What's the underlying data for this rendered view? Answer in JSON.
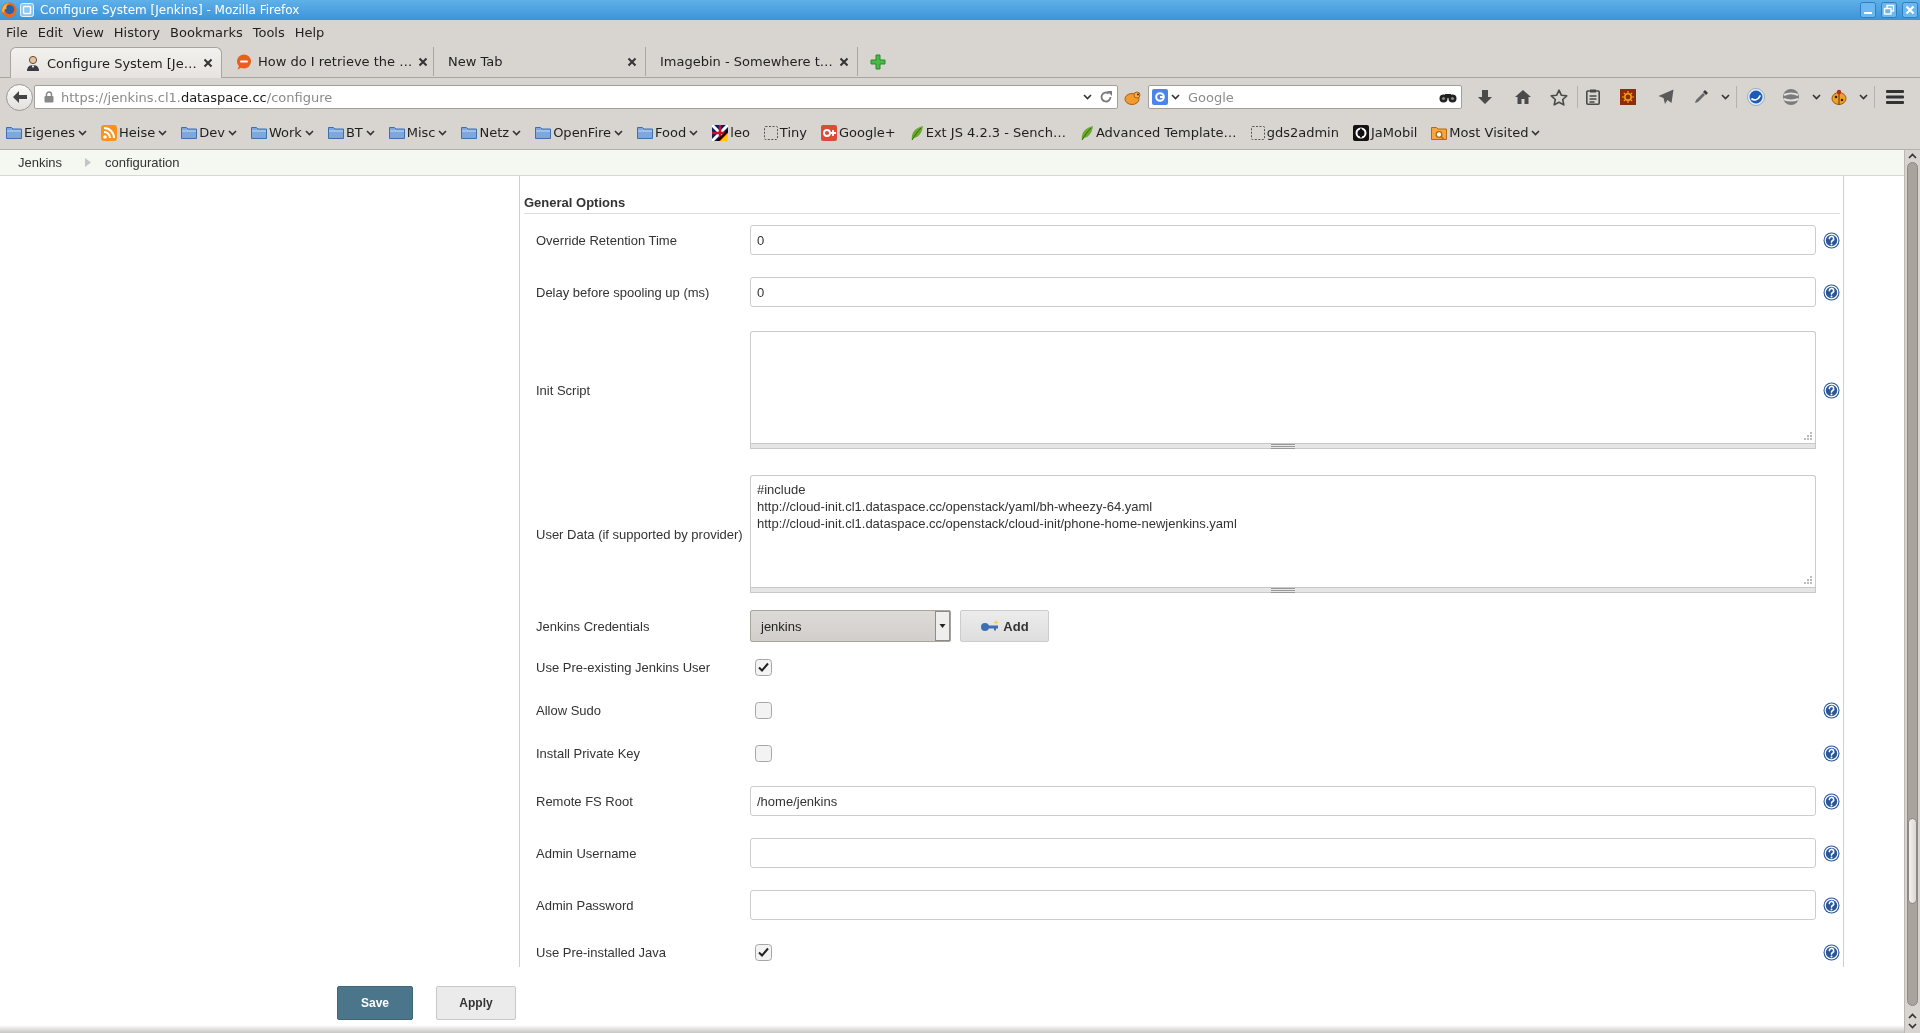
{
  "window": {
    "title": "Configure System [Jenkins] - Mozilla Firefox"
  },
  "menu": [
    "File",
    "Edit",
    "View",
    "History",
    "Bookmarks",
    "Tools",
    "Help"
  ],
  "tabs": [
    {
      "label": "Configure System [Je…",
      "selected": true,
      "kind": "person"
    },
    {
      "label": "How do I retrieve the …",
      "selected": false,
      "kind": "bubble"
    },
    {
      "label": "New Tab",
      "selected": false,
      "kind": "blank"
    },
    {
      "label": "Imagebin - Somewhere t…",
      "selected": false,
      "kind": "blank"
    }
  ],
  "address": {
    "parts": [
      {
        "text": "https://jenkins.cl1.",
        "strong": false
      },
      {
        "text": "dataspace.cc",
        "strong": true
      },
      {
        "text": "/configure",
        "strong": false
      }
    ]
  },
  "search": {
    "placeholder": "Google"
  },
  "bookmarks": [
    {
      "label": "Eigenes",
      "kind": "folder",
      "menu": true
    },
    {
      "label": "Heise",
      "kind": "feed",
      "menu": true
    },
    {
      "label": "Dev",
      "kind": "folder",
      "menu": true
    },
    {
      "label": "Work",
      "kind": "folder",
      "menu": true
    },
    {
      "label": "BT",
      "kind": "folder",
      "menu": true
    },
    {
      "label": "Misc",
      "kind": "folder",
      "menu": true
    },
    {
      "label": "Netz",
      "kind": "folder",
      "menu": true
    },
    {
      "label": "OpenFire",
      "kind": "folder",
      "menu": true
    },
    {
      "label": "Food",
      "kind": "folder",
      "menu": true
    },
    {
      "label": "leo",
      "kind": "flag",
      "menu": false
    },
    {
      "label": "Tiny",
      "kind": "blank",
      "menu": false
    },
    {
      "label": "Google+",
      "kind": "plus",
      "menu": false
    },
    {
      "label": "Ext JS 4.2.3 - Sench…",
      "kind": "leaf",
      "menu": false
    },
    {
      "label": "Advanced Template…",
      "kind": "leaf",
      "menu": false
    },
    {
      "label": "gds2admin",
      "kind": "blank",
      "menu": false
    },
    {
      "label": "JaMobil",
      "kind": "app",
      "menu": false
    },
    {
      "label": "Most Visited",
      "kind": "smart",
      "menu": true
    }
  ],
  "breadcrumbs": [
    "Jenkins",
    "configuration"
  ],
  "section": {
    "title": "General Options",
    "fields": [
      {
        "kind": "text",
        "label": "Override Retention Time",
        "value": "0",
        "help": true
      },
      {
        "kind": "text",
        "label": "Delay before spooling up (ms)",
        "value": "0",
        "help": true
      },
      {
        "kind": "textarea",
        "label": "Init Script",
        "help": true
      },
      {
        "kind": "textarea",
        "label": "User Data (if supported by provider)",
        "value": "#include\nhttp://cloud-init.cl1.dataspace.cc/openstack/yaml/bh-wheezy-64.yaml\nhttp://cloud-init.cl1.dataspace.cc/openstack/cloud-init/phone-home-newjenkins.yaml",
        "help": false
      },
      {
        "kind": "select",
        "label": "Jenkins Credentials",
        "value": "jenkins",
        "button": "Add",
        "help": false
      },
      {
        "kind": "checkbox",
        "label": "Use Pre-existing Jenkins User",
        "checked": true,
        "help": false
      },
      {
        "kind": "checkbox",
        "label": "Allow Sudo",
        "checked": false,
        "help": true
      },
      {
        "kind": "checkbox",
        "label": "Install Private Key",
        "checked": false,
        "help": true
      },
      {
        "kind": "text",
        "label": "Remote FS Root",
        "value": "/home/jenkins",
        "help": true
      },
      {
        "kind": "text",
        "label": "Admin Username",
        "help": true
      },
      {
        "kind": "text",
        "label": "Admin Password",
        "help": true
      },
      {
        "kind": "checkbox",
        "label": "Use Pre-installed Java",
        "checked": true,
        "help": true
      }
    ]
  },
  "buttons": [
    {
      "label": "Save",
      "kind": "primary"
    },
    {
      "label": "Apply",
      "kind": "secondary"
    }
  ]
}
